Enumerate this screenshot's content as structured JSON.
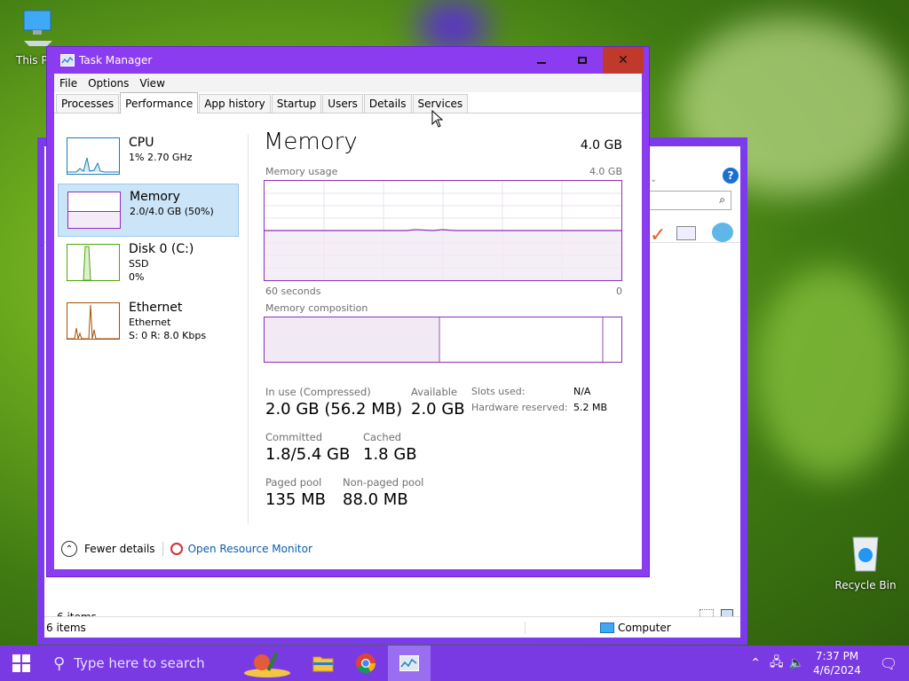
{
  "desktop": {
    "this_pc_label": "This P",
    "recycle_bin_label": "Recycle Bin"
  },
  "explorer": {
    "items_count": "6 items",
    "status_items": "6 items",
    "status_location": "Computer"
  },
  "taskmanager": {
    "title": "Task Manager",
    "menu": [
      "File",
      "Options",
      "View"
    ],
    "tabs": [
      "Processes",
      "Performance",
      "App history",
      "Startup",
      "Users",
      "Details",
      "Services"
    ],
    "active_tab": "Performance",
    "sidebar": [
      {
        "name": "CPU",
        "line1": "1% 2.70 GHz",
        "line2": "",
        "color": "#1a7bb9"
      },
      {
        "name": "Memory",
        "line1": "2.0/4.0 GB (50%)",
        "line2": "",
        "color": "#8e2fbd"
      },
      {
        "name": "Disk 0 (C:)",
        "line1": "SSD",
        "line2": "0%",
        "color": "#4da60c"
      },
      {
        "name": "Ethernet",
        "line1": "Ethernet",
        "line2": "S: 0 R: 8.0 Kbps",
        "color": "#a74f01"
      }
    ],
    "memory": {
      "title": "Memory",
      "total": "4.0 GB",
      "usage_label": "Memory usage",
      "usage_max": "4.0 GB",
      "time_left": "60 seconds",
      "time_right": "0",
      "composition_label": "Memory composition",
      "in_use_label": "In use (Compressed)",
      "in_use_value": "2.0 GB (56.2 MB)",
      "available_label": "Available",
      "available_value": "2.0 GB",
      "slots_label": "Slots used:",
      "slots_value": "N/A",
      "hw_reserved_label": "Hardware reserved:",
      "hw_reserved_value": "5.2 MB",
      "committed_label": "Committed",
      "committed_value": "1.8/5.4 GB",
      "cached_label": "Cached",
      "cached_value": "1.8 GB",
      "paged_label": "Paged pool",
      "paged_value": "135 MB",
      "nonpaged_label": "Non-paged pool",
      "nonpaged_value": "88.0 MB",
      "usage_fraction": 0.5,
      "composition_in_use_fraction": 0.5
    },
    "footer": {
      "fewer_details": "Fewer details",
      "open_resource_monitor": "Open Resource Monitor"
    }
  },
  "taskbar": {
    "search_placeholder": "Type here to search",
    "time": "7:37 PM",
    "date": "4/6/2024"
  },
  "colors": {
    "accent": "#7a3ae3",
    "memory": "#8e2fbd"
  }
}
